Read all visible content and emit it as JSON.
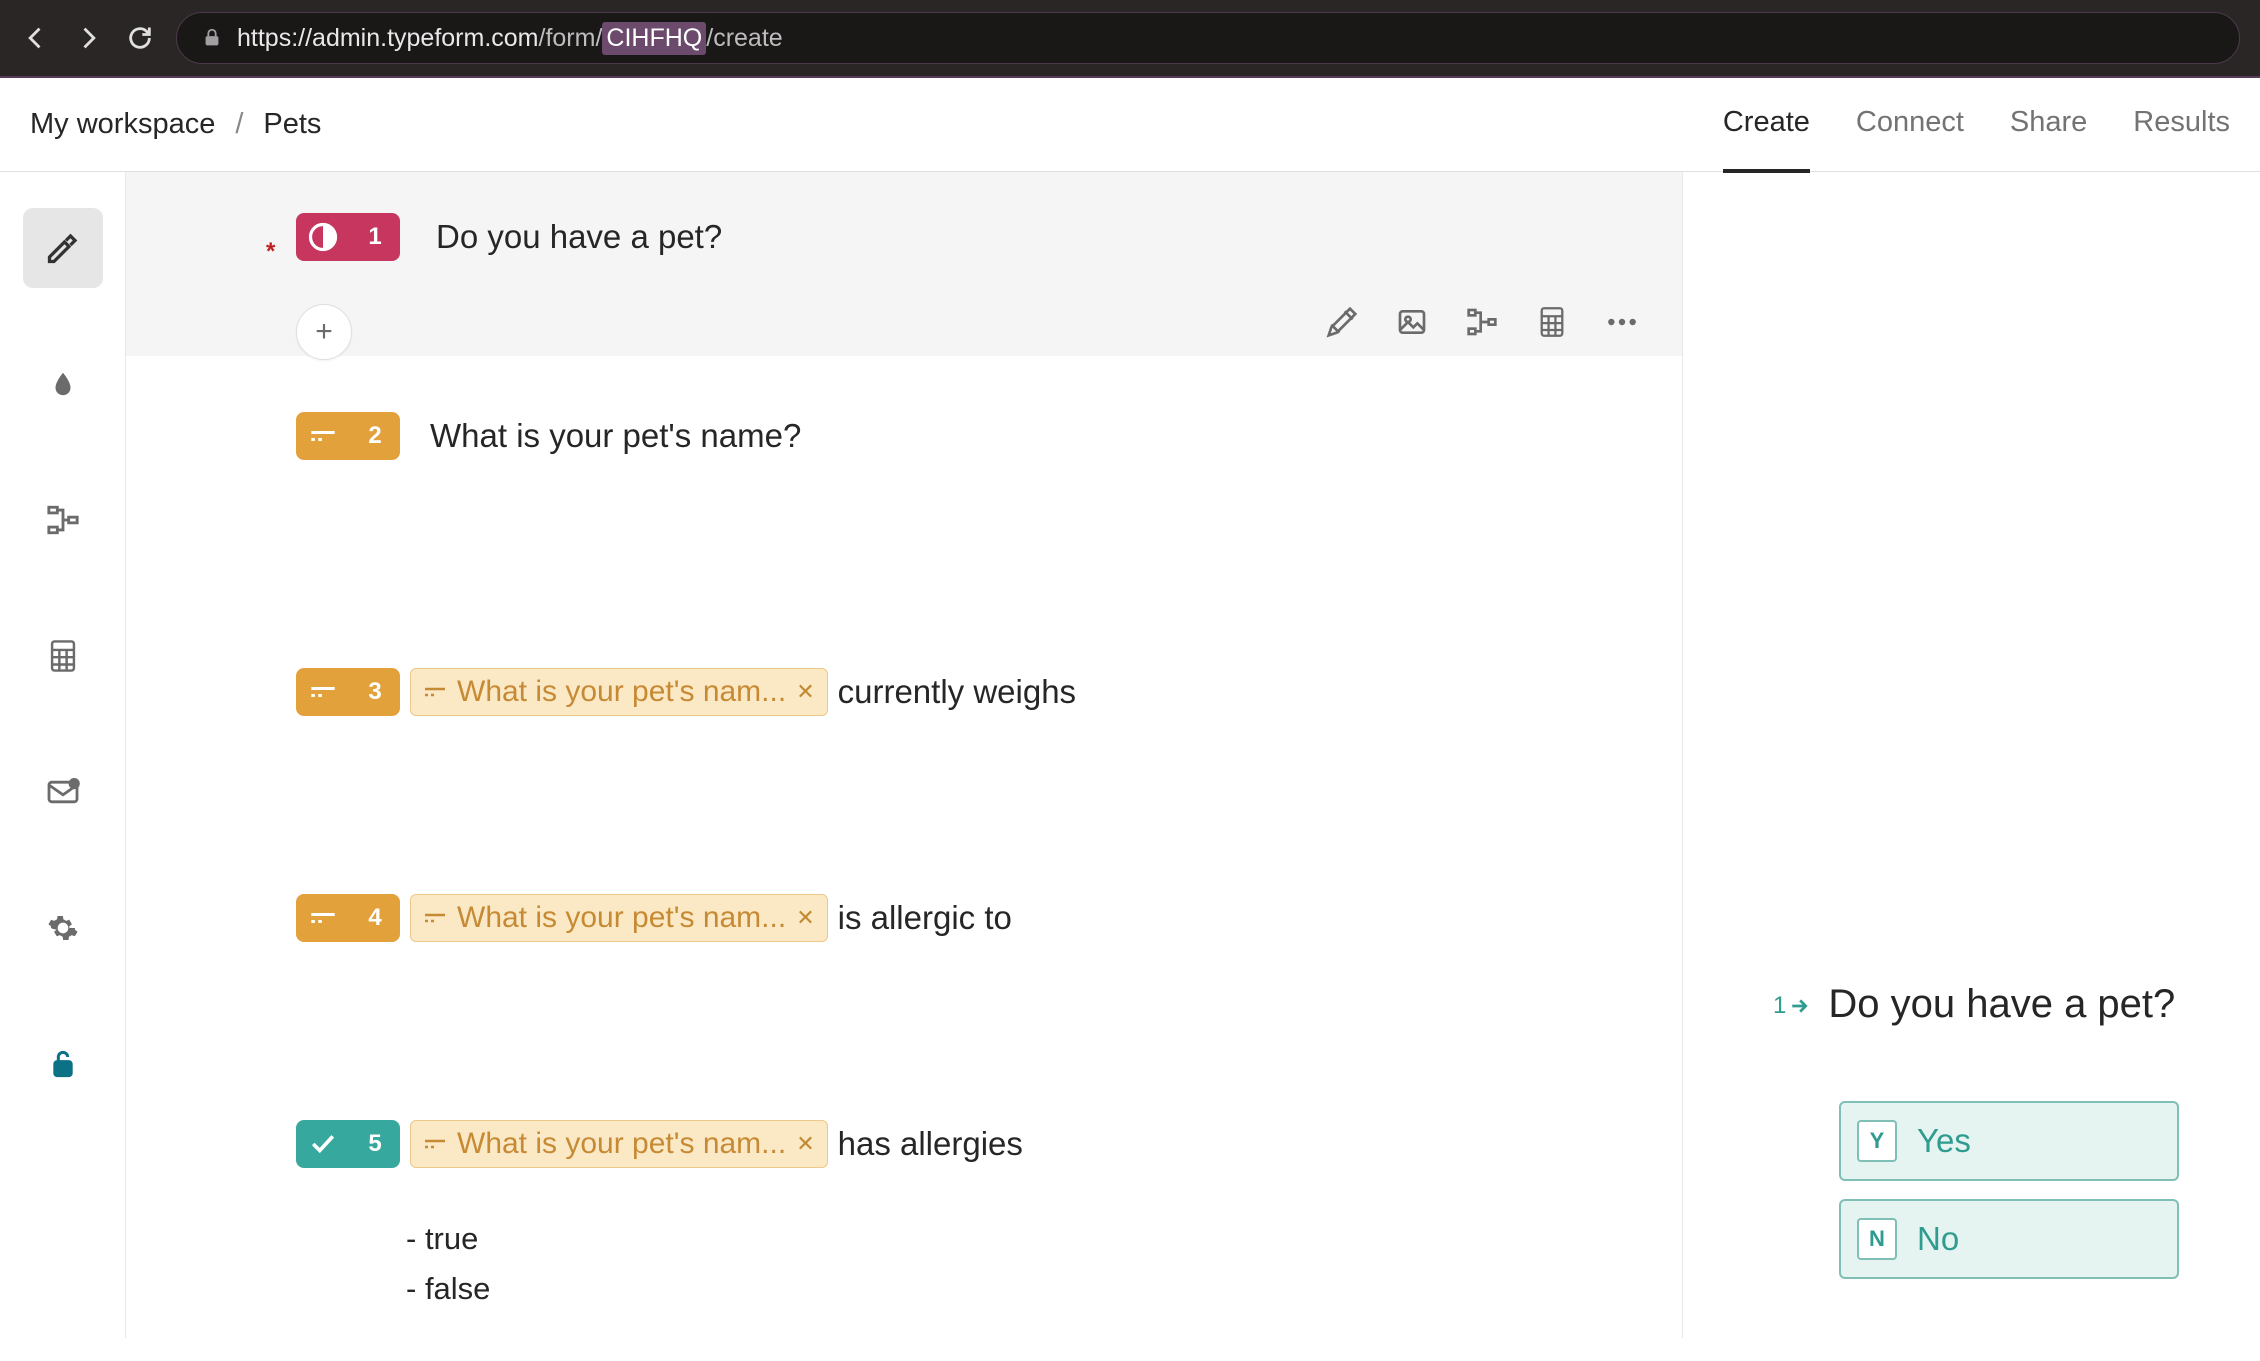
{
  "url": {
    "scheme_domain": "https://admin.typeform.com",
    "path_pre": "/form/",
    "path_highlight": "CIHFHQ",
    "path_post": "/create"
  },
  "breadcrumb": {
    "workspace": "My workspace",
    "form": "Pets"
  },
  "tabs": {
    "create": "Create",
    "connect": "Connect",
    "share": "Share",
    "results": "Results"
  },
  "questions": [
    {
      "num": "1",
      "type": "yesno",
      "title": "Do you have a pet?"
    },
    {
      "num": "2",
      "type": "short",
      "title": "What is your pet's name?",
      "required": true
    },
    {
      "num": "3",
      "type": "short",
      "recall": "What is your pet's nam...",
      "after": "currently weighs"
    },
    {
      "num": "4",
      "type": "short",
      "recall": "What is your pet's nam...",
      "after": "is allergic to"
    },
    {
      "num": "5",
      "type": "yesno_teal",
      "recall": "What is your pet's nam...",
      "after": "has allergies",
      "options": [
        "true",
        "false"
      ]
    }
  ],
  "preview": {
    "num": "1",
    "title": "Do you have a pet?",
    "options": [
      {
        "key": "Y",
        "label": "Yes"
      },
      {
        "key": "N",
        "label": "No"
      }
    ]
  }
}
